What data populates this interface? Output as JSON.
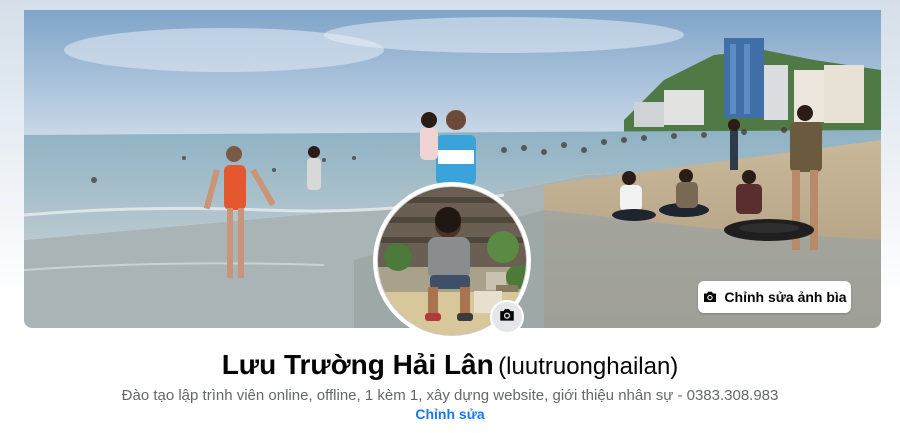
{
  "cover": {
    "edit_button_label": "Chỉnh sửa ảnh bìa",
    "camera_icon": "camera-icon"
  },
  "profile": {
    "name": "Lưu Trường Hải Lân",
    "username": "(luutruonghailan)",
    "bio": "Đào tạo lập trình viên online, offline, 1 kèm 1, xây dựng website, giới thiệu nhân sự - 0383.308.983",
    "edit_bio_label": "Chỉnh sửa",
    "avatar_camera_icon": "camera-icon"
  },
  "colors": {
    "link": "#1877f2",
    "secondary_text": "#65676b",
    "primary_text": "#050505"
  }
}
